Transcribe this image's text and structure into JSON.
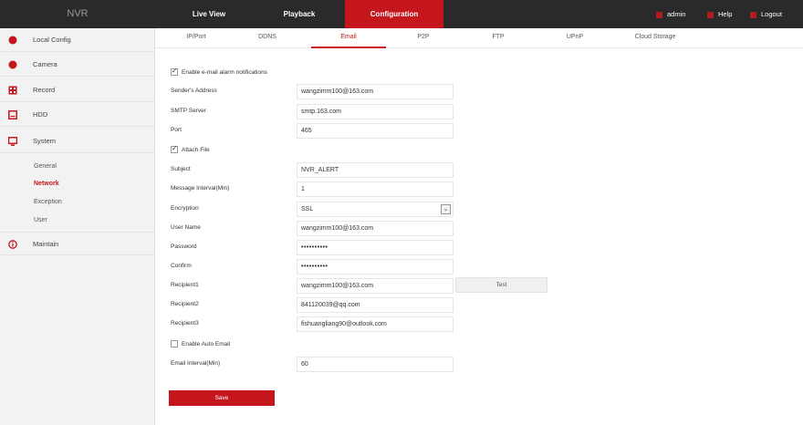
{
  "app": {
    "logo": "NVR"
  },
  "nav": {
    "items": [
      "Live View",
      "Playback",
      "Configuration"
    ]
  },
  "topright": {
    "admin": "admin",
    "help": "Help",
    "logout": "Logout"
  },
  "sidebar": {
    "items": [
      "Local Config",
      "Camera",
      "Record",
      "HDD",
      "System",
      "Maintain"
    ],
    "system_sub": [
      "General",
      "Network",
      "Exception",
      "User"
    ]
  },
  "tabs": [
    "IP/Port",
    "DDNS",
    "Email",
    "P2P",
    "FTP",
    "UPnP",
    "Cloud Storage"
  ],
  "form": {
    "enable_alarm": "Enable e-mail alarm notifications",
    "sender_label": "Sender's Address",
    "sender_value": "wangzimm100@163.com",
    "smtp_label": "SMTP Server",
    "smtp_value": "smtp.163.com",
    "port_label": "Port",
    "port_value": "465",
    "attach_label": "Attach File",
    "subject_label": "Subject",
    "subject_value": "NVR_ALERT",
    "interval_label": "Message Interval(Min)",
    "interval_value": "1",
    "encryption_label": "Encryption",
    "encryption_value": "SSL",
    "username_label": "User Name",
    "username_value": "wangzimm100@163.com",
    "password_label": "Password",
    "password_value": "••••••••••",
    "confirm_label": "Confirm",
    "confirm_value": "••••••••••",
    "recipient1_label": "Recipient1",
    "recipient1_value": "wangzimm100@163.com",
    "test_label": "Test",
    "recipient2_label": "Recipient2",
    "recipient2_value": "841120039@qq.com",
    "recipient3_label": "Recipient3",
    "recipient3_value": "fishuangliang90@outlook.com",
    "auto_email_label": "Enable Auto Email",
    "email_interval_label": "Email Interval(Min)",
    "email_interval_value": "60",
    "save_label": "Save"
  },
  "colors": {
    "accent": "#c4161c",
    "topbar": "#2a2a2a",
    "sidebar": "#f2f2f2"
  }
}
